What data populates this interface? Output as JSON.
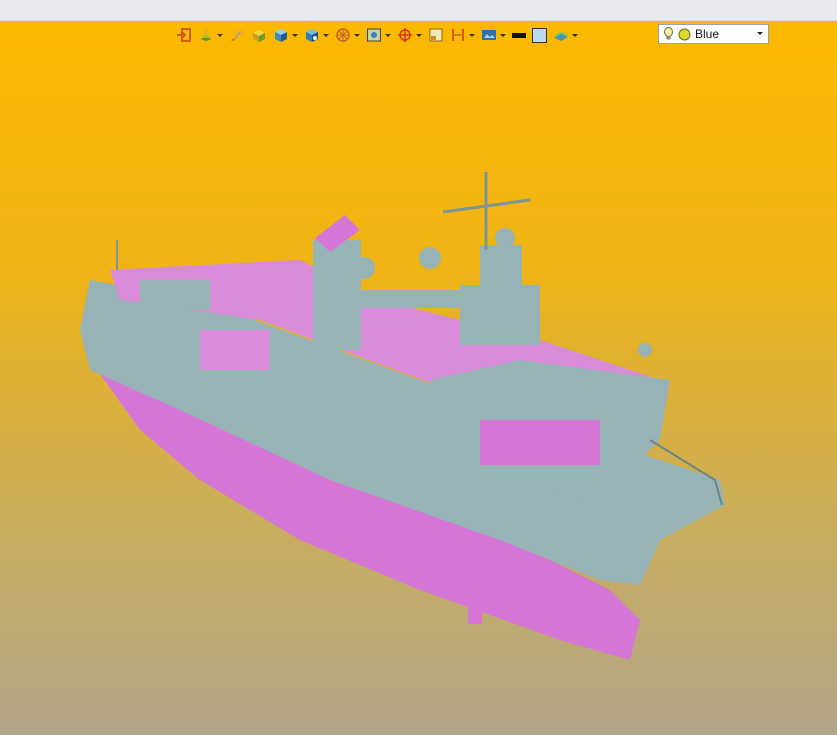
{
  "light_selector": {
    "value": "Blue"
  },
  "colors": {
    "hull_upper": "#97b3b6",
    "hull_lower": "#d676d6",
    "background_top": "#fbb900",
    "background_bottom": "#b2a58a"
  },
  "toolbar": {
    "tools": [
      "exit-icon",
      "layers-icon",
      "brush-icon",
      "box-shaded-icon",
      "cube-icon",
      "cube-view-icon",
      "wheel-icon",
      "display-icon",
      "target-icon",
      "sheet-icon",
      "section-icon",
      "render-icon",
      "line-color-icon",
      "fill-color-icon",
      "plane-icon"
    ]
  }
}
